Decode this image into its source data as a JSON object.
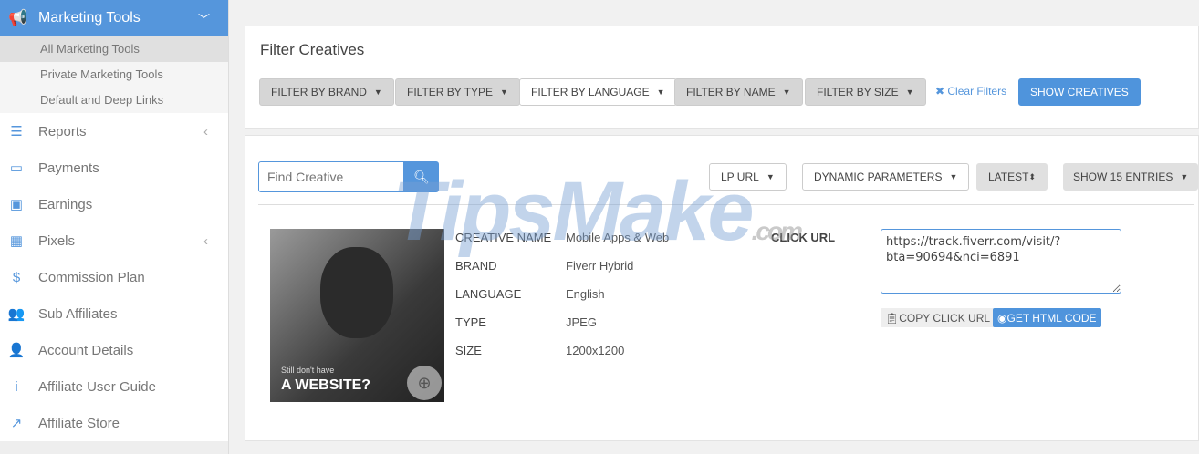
{
  "sidebar": {
    "header": "Marketing Tools",
    "sub": [
      "All Marketing Tools",
      "Private Marketing Tools",
      "Default and Deep Links"
    ],
    "items": [
      "Reports",
      "Payments",
      "Earnings",
      "Pixels",
      "Commission Plan",
      "Sub Affiliates",
      "Account Details",
      "Affiliate User Guide",
      "Affiliate Store"
    ]
  },
  "filter": {
    "title": "Filter Creatives",
    "brand": "FILTER BY BRAND",
    "type": "FILTER BY TYPE",
    "language": "FILTER BY LANGUAGE",
    "name": "FILTER BY NAME",
    "size": "FILTER BY SIZE",
    "clear": "Clear Filters",
    "show": "SHOW CREATIVES"
  },
  "toolbar": {
    "search_placeholder": "Find Creative",
    "lp_url": "LP URL",
    "dynamic": "DYNAMIC PARAMETERS",
    "latest": "LATEST",
    "entries": "SHOW 15 ENTRIES"
  },
  "creative": {
    "image_text1": "Still don't have",
    "image_text2": "A WEBSITE?",
    "labels": [
      "CREATIVE NAME",
      "BRAND",
      "LANGUAGE",
      "TYPE",
      "SIZE"
    ],
    "values": [
      "Mobile Apps & Web",
      "Fiverr Hybrid",
      "English",
      "JPEG",
      "1200x1200"
    ],
    "click_url_label": "CLICK URL",
    "click_url": "https://track.fiverr.com/visit/?bta=90694&nci=6891",
    "copy": "COPY CLICK URL",
    "html": "GET HTML CODE"
  },
  "watermark": {
    "main": "TipsMake",
    ".com": ".com"
  }
}
